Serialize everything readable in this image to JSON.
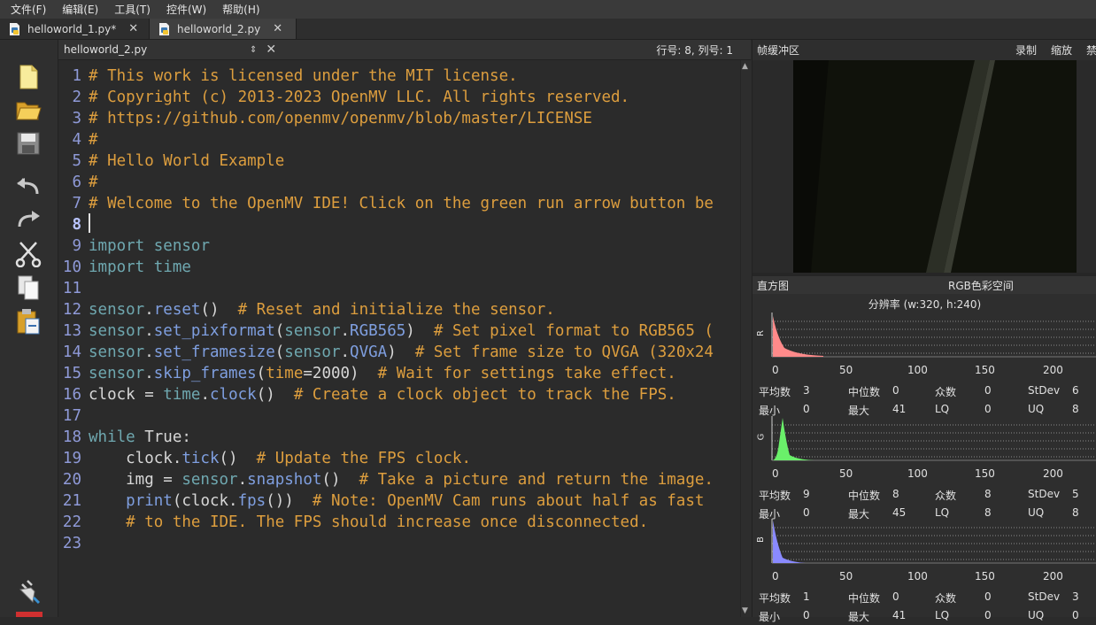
{
  "menu": [
    "文件(F)",
    "编辑(E)",
    "工具(T)",
    "控件(W)",
    "帮助(H)"
  ],
  "tabs": [
    {
      "label": "helloworld_1.py*",
      "close": "✕"
    },
    {
      "label": "helloworld_2.py",
      "close": "✕"
    }
  ],
  "editor_header": {
    "filename": "helloworld_2.py",
    "updown": "⇕",
    "close": "✕",
    "position": "行号: 8, 列号: 1"
  },
  "code_lines": [
    {
      "n": "1",
      "tokens": [
        [
          "comment",
          "# This work is licensed under the MIT license."
        ]
      ]
    },
    {
      "n": "2",
      "tokens": [
        [
          "comment",
          "# Copyright (c) 2013-2023 OpenMV LLC. All rights reserved."
        ]
      ]
    },
    {
      "n": "3",
      "tokens": [
        [
          "comment",
          "# https://github.com/openmv/openmv/blob/master/LICENSE"
        ]
      ]
    },
    {
      "n": "4",
      "tokens": [
        [
          "comment",
          "#"
        ]
      ]
    },
    {
      "n": "5",
      "tokens": [
        [
          "comment",
          "# Hello World Example"
        ]
      ]
    },
    {
      "n": "6",
      "tokens": [
        [
          "comment",
          "#"
        ]
      ]
    },
    {
      "n": "7",
      "tokens": [
        [
          "comment",
          "# Welcome to the OpenMV IDE! Click on the green run arrow button be"
        ]
      ]
    },
    {
      "n": "8",
      "tokens": [],
      "current": true
    },
    {
      "n": "9",
      "tokens": [
        [
          "kw",
          "import"
        ],
        [
          "plain",
          " "
        ],
        [
          "mod",
          "sensor"
        ]
      ]
    },
    {
      "n": "10",
      "tokens": [
        [
          "kw",
          "import"
        ],
        [
          "plain",
          " "
        ],
        [
          "mod",
          "time"
        ]
      ]
    },
    {
      "n": "11",
      "tokens": []
    },
    {
      "n": "12",
      "tokens": [
        [
          "mod",
          "sensor"
        ],
        [
          "plain",
          "."
        ],
        [
          "fn",
          "reset"
        ],
        [
          "plain",
          "()  "
        ],
        [
          "comment",
          "# Reset and initialize the sensor."
        ]
      ]
    },
    {
      "n": "13",
      "tokens": [
        [
          "mod",
          "sensor"
        ],
        [
          "plain",
          "."
        ],
        [
          "fn",
          "set_pixformat"
        ],
        [
          "plain",
          "("
        ],
        [
          "mod",
          "sensor"
        ],
        [
          "plain",
          "."
        ],
        [
          "fn",
          "RGB565"
        ],
        [
          "plain",
          ")  "
        ],
        [
          "comment",
          "# Set pixel format to RGB565 ("
        ]
      ]
    },
    {
      "n": "14",
      "tokens": [
        [
          "mod",
          "sensor"
        ],
        [
          "plain",
          "."
        ],
        [
          "fn",
          "set_framesize"
        ],
        [
          "plain",
          "("
        ],
        [
          "mod",
          "sensor"
        ],
        [
          "plain",
          "."
        ],
        [
          "fn",
          "QVGA"
        ],
        [
          "plain",
          ")  "
        ],
        [
          "comment",
          "# Set frame size to QVGA (320x24"
        ]
      ]
    },
    {
      "n": "15",
      "tokens": [
        [
          "mod",
          "sensor"
        ],
        [
          "plain",
          "."
        ],
        [
          "fn",
          "skip_frames"
        ],
        [
          "plain",
          "("
        ],
        [
          "kwarg",
          "time"
        ],
        [
          "plain",
          "=2000)  "
        ],
        [
          "comment",
          "# Wait for settings take effect."
        ]
      ]
    },
    {
      "n": "16",
      "tokens": [
        [
          "plain",
          "clock = "
        ],
        [
          "mod",
          "time"
        ],
        [
          "plain",
          "."
        ],
        [
          "fn",
          "clock"
        ],
        [
          "plain",
          "()  "
        ],
        [
          "comment",
          "# Create a clock object to track the FPS."
        ]
      ]
    },
    {
      "n": "17",
      "tokens": []
    },
    {
      "n": "18",
      "tokens": [
        [
          "kw",
          "while"
        ],
        [
          "plain",
          " True:"
        ]
      ]
    },
    {
      "n": "19",
      "tokens": [
        [
          "plain",
          "    clock."
        ],
        [
          "fn",
          "tick"
        ],
        [
          "plain",
          "()  "
        ],
        [
          "comment",
          "# Update the FPS clock."
        ]
      ]
    },
    {
      "n": "20",
      "tokens": [
        [
          "plain",
          "    img = "
        ],
        [
          "mod",
          "sensor"
        ],
        [
          "plain",
          "."
        ],
        [
          "fn",
          "snapshot"
        ],
        [
          "plain",
          "()  "
        ],
        [
          "comment",
          "# Take a picture and return the image."
        ]
      ]
    },
    {
      "n": "21",
      "tokens": [
        [
          "plain",
          "    "
        ],
        [
          "fn",
          "print"
        ],
        [
          "plain",
          "(clock."
        ],
        [
          "fn",
          "fps"
        ],
        [
          "plain",
          "())  "
        ],
        [
          "comment",
          "# Note: OpenMV Cam runs about half as fast"
        ]
      ]
    },
    {
      "n": "22",
      "tokens": [
        [
          "plain",
          "    "
        ],
        [
          "comment",
          "# to the IDE. The FPS should increase once disconnected."
        ]
      ]
    },
    {
      "n": "23",
      "tokens": []
    }
  ],
  "framebuffer": {
    "title": "帧缓冲区",
    "actions": [
      "录制",
      "缩放",
      "禁"
    ]
  },
  "histogram": {
    "title": "直方图",
    "colorspace": "RGB色彩空间",
    "resolution": "分辨率 (w:320, h:240)",
    "ticks": [
      "0",
      "50",
      "100",
      "150",
      "200"
    ],
    "channels": [
      {
        "name": "R",
        "color": "#ff8a8a",
        "stats": [
          [
            "平均数",
            "3",
            "中位数",
            "0",
            "众数",
            "0",
            "StDev",
            "6"
          ],
          [
            "最小",
            "0",
            "最大",
            "41",
            "LQ",
            "0",
            "UQ",
            "8"
          ]
        ]
      },
      {
        "name": "G",
        "color": "#6af06a",
        "stats": [
          [
            "平均数",
            "9",
            "中位数",
            "8",
            "众数",
            "8",
            "StDev",
            "5"
          ],
          [
            "最小",
            "0",
            "最大",
            "45",
            "LQ",
            "8",
            "UQ",
            "8"
          ]
        ]
      },
      {
        "name": "B",
        "color": "#8a8aff",
        "stats": [
          [
            "平均数",
            "1",
            "中位数",
            "0",
            "众数",
            "0",
            "StDev",
            "3"
          ],
          [
            "最小",
            "0",
            "最大",
            "41",
            "LQ",
            "0",
            "UQ",
            "0"
          ]
        ]
      }
    ]
  }
}
